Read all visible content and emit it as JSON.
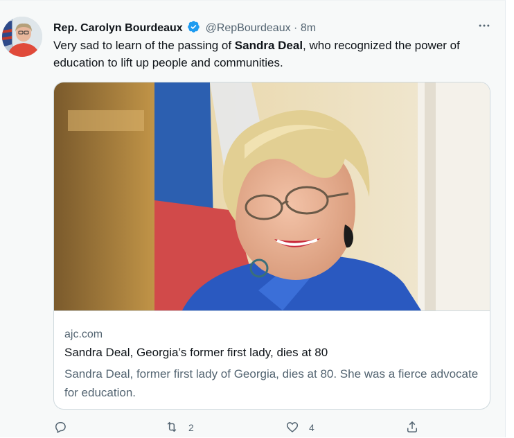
{
  "author": {
    "name": "Rep. Carolyn Bourdeaux",
    "handle": "@RepBourdeaux",
    "separator": "·",
    "time": "8m"
  },
  "tweet": {
    "text_before": "Very sad to learn of the passing of ",
    "bold": "Sandra Deal",
    "text_after": ", who recognized the power of education to lift up people and communities."
  },
  "card": {
    "domain": "ajc.com",
    "title": "Sandra Deal, Georgia’s former first lady, dies at 80",
    "description": "Sandra Deal, former first lady of Georgia, dies at 80. She was a fierce advocate for education."
  },
  "actions": {
    "reply_count": "",
    "retweet_count": "2",
    "like_count": "4"
  },
  "icons": {
    "more": "more-horizontal-icon",
    "verified": "verified-badge-icon",
    "reply": "reply-icon",
    "retweet": "retweet-icon",
    "like": "like-icon",
    "share": "share-icon"
  },
  "colors": {
    "verified": "#1d9bf0",
    "secondary_text": "#536471",
    "primary_text": "#0f1419"
  }
}
